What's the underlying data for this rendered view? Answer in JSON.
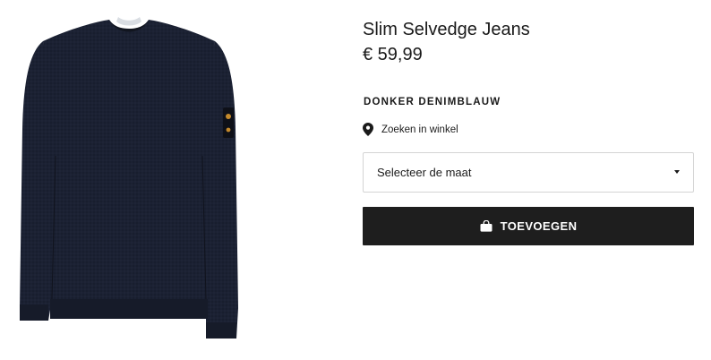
{
  "product": {
    "image_alt": "Donkerblauwe sweater",
    "title": "Slim Selvedge Jeans",
    "price": "€ 59,99",
    "color": "DONKER DENIMBLAUW",
    "colors": {
      "garment": "#1b2133",
      "button_bg": "#1e1e1e"
    }
  },
  "store_link": {
    "icon": "map-pin-icon",
    "label": "Zoeken in winkel"
  },
  "size_select": {
    "selected": "Selecteer de maat",
    "icon": "chevron-down-icon"
  },
  "add_button": {
    "icon": "shopping-bag-icon",
    "label": "TOEVOEGEN"
  }
}
